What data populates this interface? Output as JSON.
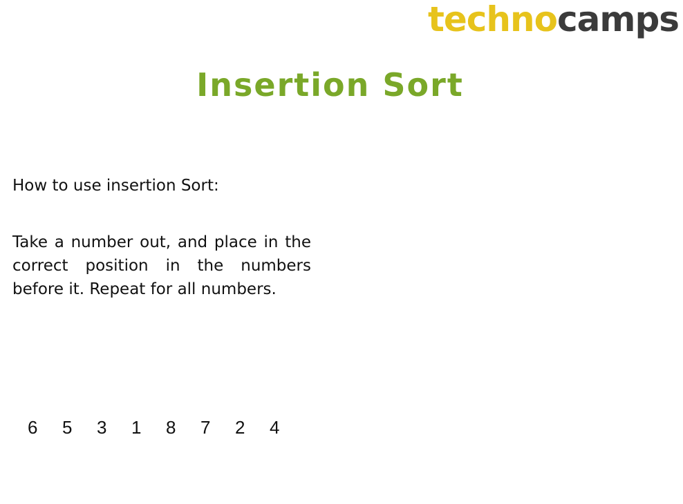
{
  "logo": {
    "part1": "techno",
    "part2": "camps",
    "color1": "#e7c31c",
    "color2": "#3b3b3b"
  },
  "title": "Insertion Sort",
  "title_color": "#7aa829",
  "intro": "How to use insertion Sort:",
  "instructions": "Take a number out, and place in the correct position in the numbers before it. Repeat for all numbers.",
  "numbers": [
    "6",
    "5",
    "3",
    "1",
    "8",
    "7",
    "2",
    "4"
  ]
}
